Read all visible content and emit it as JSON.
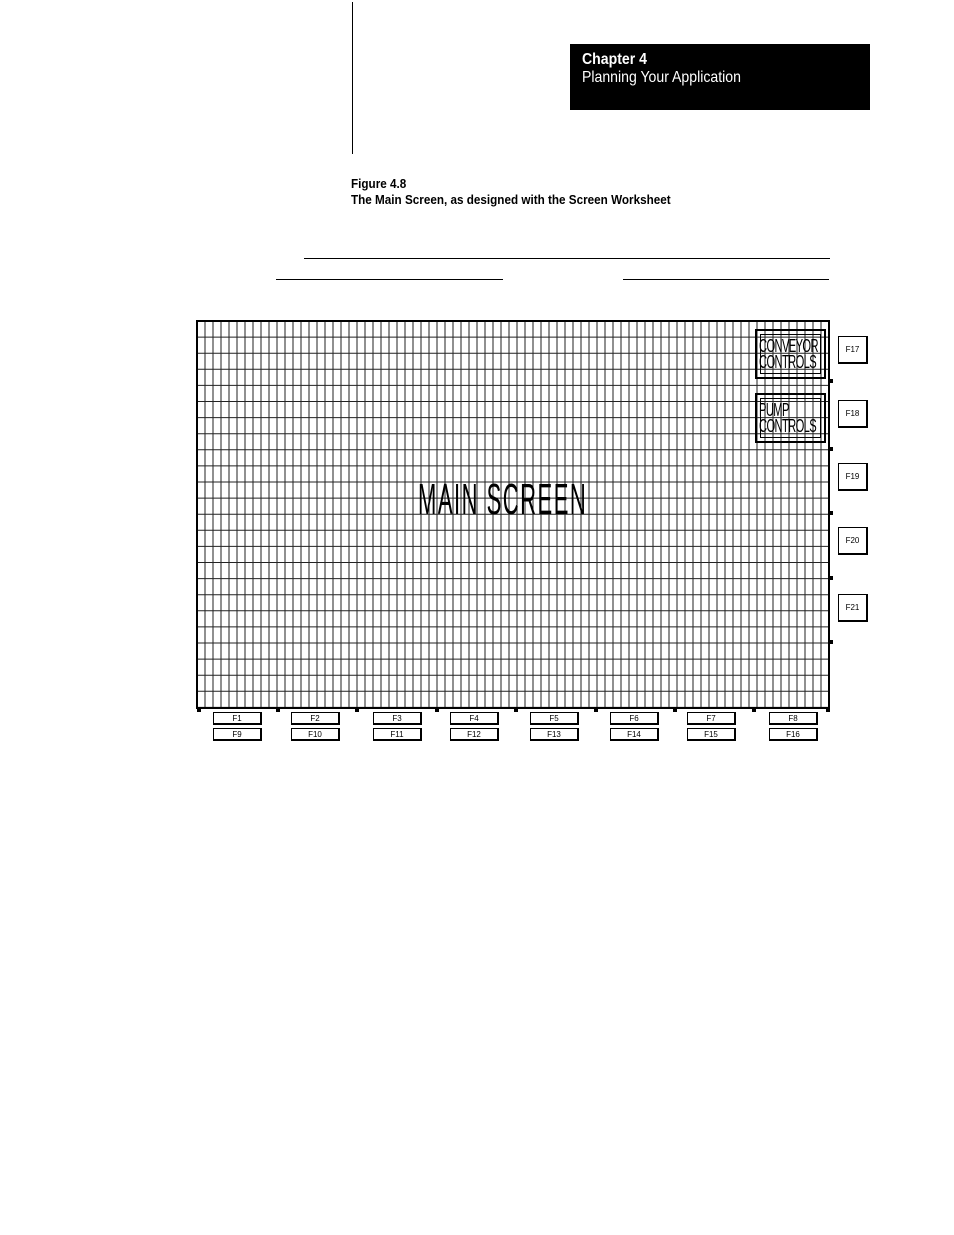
{
  "header": {
    "chapter_number": "Chapter 4",
    "chapter_title": "Planning Your Application"
  },
  "figure": {
    "label": "Figure 4.8",
    "caption": "The Main Screen, as designed with the Screen Worksheet"
  },
  "worksheet": {
    "screen_title": "MAIN SCREEN",
    "buttons": [
      {
        "line1": "CONVEYOR",
        "line2": "CONTROLS"
      },
      {
        "line1": "PUMP",
        "line2": "CONTROLS"
      }
    ],
    "bottom_keys_row1": [
      "F1",
      "F2",
      "F3",
      "F4",
      "F5",
      "F6",
      "F7",
      "F8"
    ],
    "bottom_keys_row2": [
      "F9",
      "F10",
      "F11",
      "F12",
      "F13",
      "F14",
      "F15",
      "F16"
    ],
    "side_keys": [
      "F17",
      "F18",
      "F19",
      "F20",
      "F21"
    ]
  }
}
